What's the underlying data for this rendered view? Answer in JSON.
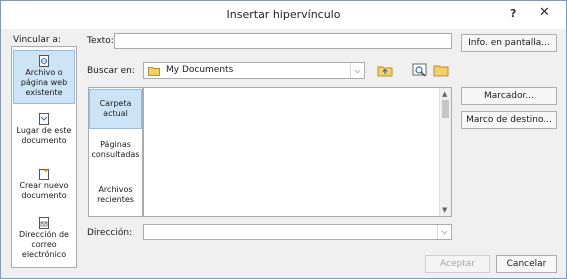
{
  "window": {
    "title": "Insertar hipervínculo",
    "help_label": "?",
    "close_label": "✕"
  },
  "link_to": {
    "label": "Vincular a:",
    "items": [
      {
        "label_line1": "Archivo o",
        "label_line2": "página web",
        "label_line3": "existente",
        "icon": "web-page-file-icon",
        "selected": true
      },
      {
        "label_line1": "Lugar de este",
        "label_line2": "documento",
        "icon": "document-place-icon",
        "selected": false
      },
      {
        "label_line1": "Crear nuevo",
        "label_line2": "documento",
        "icon": "new-document-icon",
        "selected": false
      },
      {
        "label_line1": "Dirección de",
        "label_line2": "correo",
        "label_line3": "electrónico",
        "icon": "email-icon",
        "selected": false
      }
    ]
  },
  "text": {
    "label": "Texto:",
    "value": ""
  },
  "screentip_button": "Info. en pantalla...",
  "look_in": {
    "label": "Buscar en:",
    "value": "My Documents",
    "icon": "folder-icon"
  },
  "toolbar_icons": [
    "up-folder-icon",
    "browse-web-icon",
    "browse-file-icon"
  ],
  "nav": {
    "items": [
      {
        "line1": "Carpeta",
        "line2": "actual",
        "selected": true
      },
      {
        "line1": "Páginas",
        "line2": "consultadas",
        "selected": false
      },
      {
        "line1": "Archivos",
        "line2": "recientes",
        "selected": false
      }
    ]
  },
  "bookmark_button": "Marcador...",
  "target_frame_button": "Marco de destino...",
  "address": {
    "label": "Dirección:",
    "value": ""
  },
  "ok_button": "Aceptar",
  "cancel_button": "Cancelar"
}
